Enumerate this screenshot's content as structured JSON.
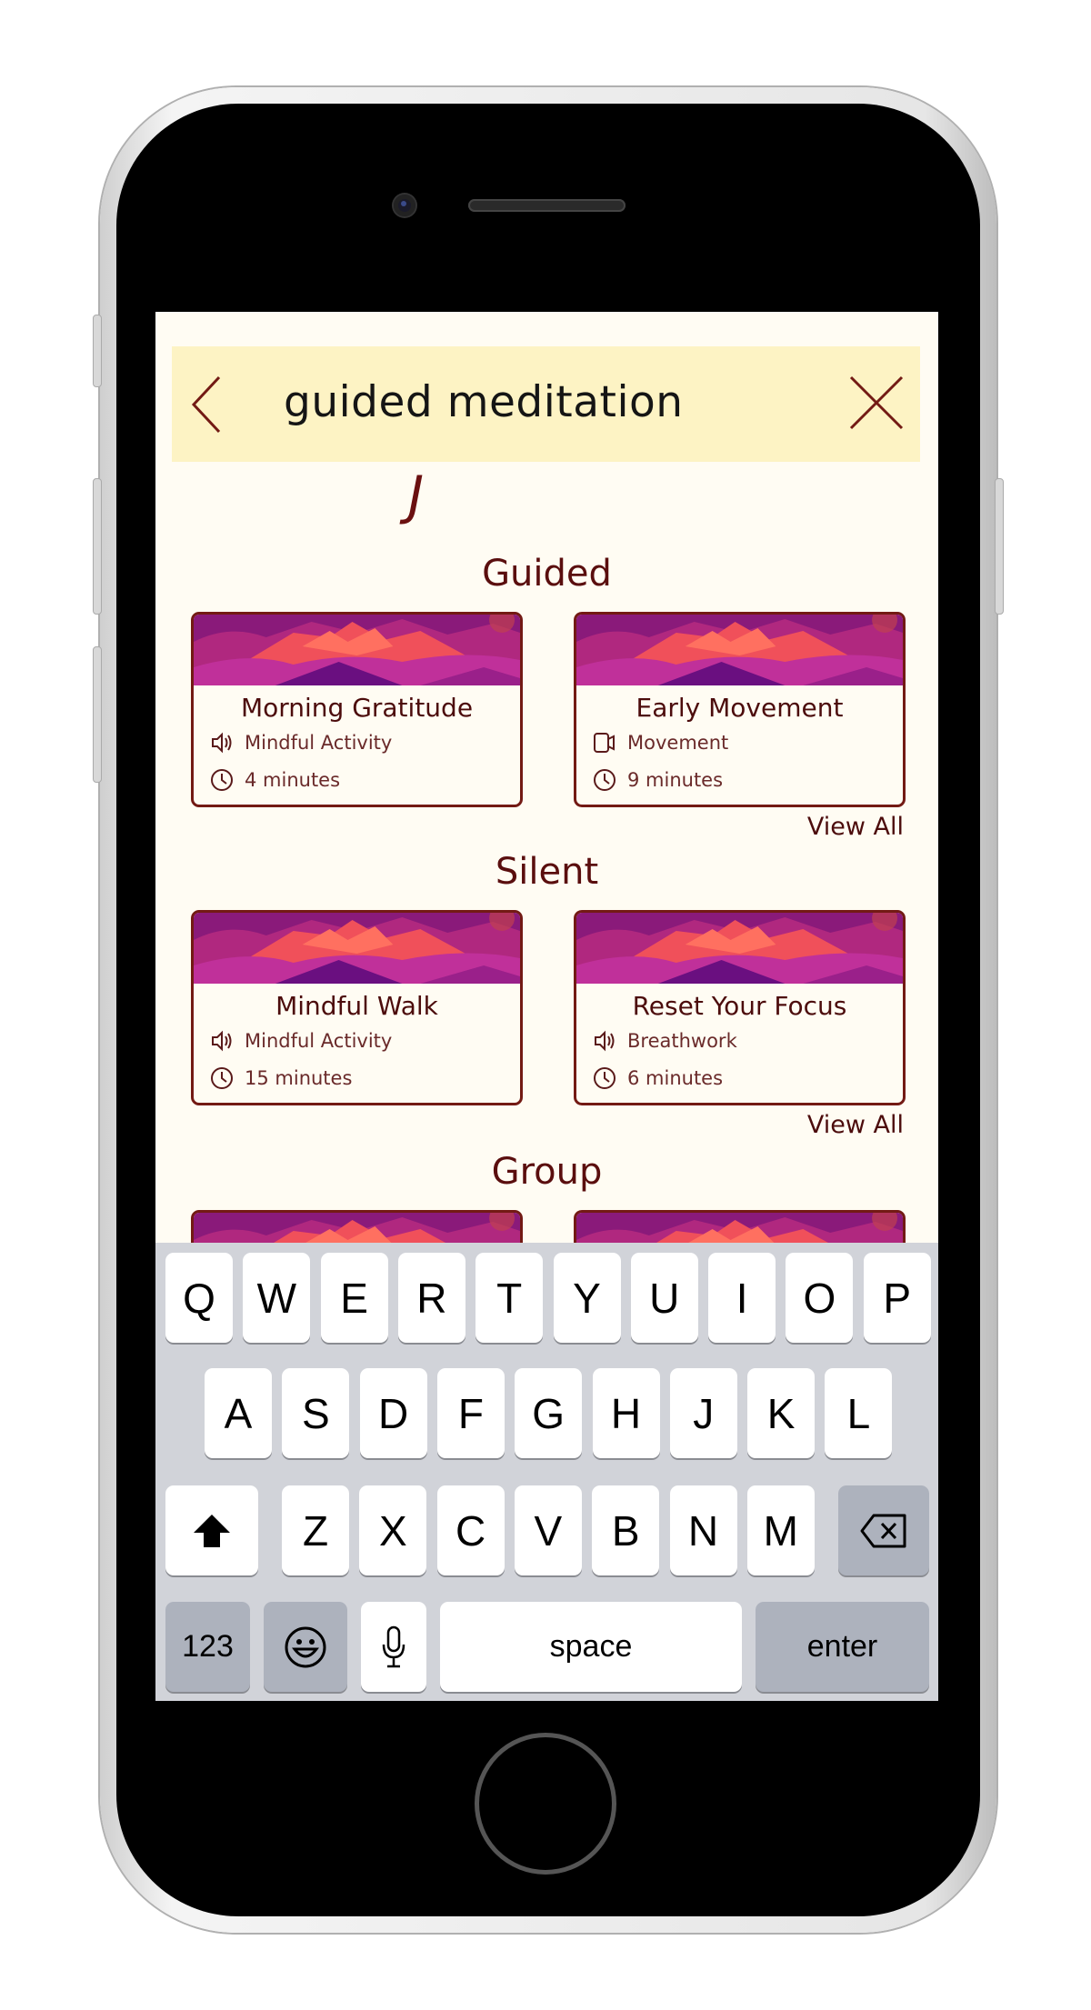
{
  "search": {
    "query": "guided meditation",
    "back_icon": "chevron-left-icon",
    "clear_icon": "close-icon"
  },
  "stray_glyph": "J",
  "colors": {
    "accent": "#731a14",
    "search_bg": "#fdf3c4",
    "page_bg": "#fffcf3",
    "keyboard_bg": "#d1d3d9"
  },
  "sections": [
    {
      "title": "Guided",
      "view_all": "View All",
      "cards": [
        {
          "title": "Morning Gratitude",
          "type": "Mindful Activity",
          "type_icon": "speaker-icon",
          "duration": "4 minutes"
        },
        {
          "title": "Early Movement",
          "type": "Movement",
          "type_icon": "video-camera-icon",
          "duration": "9 minutes"
        }
      ]
    },
    {
      "title": "Silent",
      "view_all": "View All",
      "cards": [
        {
          "title": "Mindful Walk",
          "type": "Mindful Activity",
          "type_icon": "speaker-icon",
          "duration": "15 minutes"
        },
        {
          "title": "Reset Your Focus",
          "type": "Breathwork",
          "type_icon": "speaker-icon",
          "duration": "6 minutes"
        }
      ]
    },
    {
      "title": "Group",
      "cards": [
        {},
        {}
      ]
    }
  ],
  "keyboard": {
    "row1": [
      "Q",
      "W",
      "E",
      "R",
      "T",
      "Y",
      "U",
      "I",
      "O",
      "P"
    ],
    "row2": [
      "A",
      "S",
      "D",
      "F",
      "G",
      "H",
      "J",
      "K",
      "L"
    ],
    "row3": [
      "Z",
      "X",
      "C",
      "V",
      "B",
      "N",
      "M"
    ],
    "numbers": "123",
    "space": "space",
    "enter": "enter"
  }
}
